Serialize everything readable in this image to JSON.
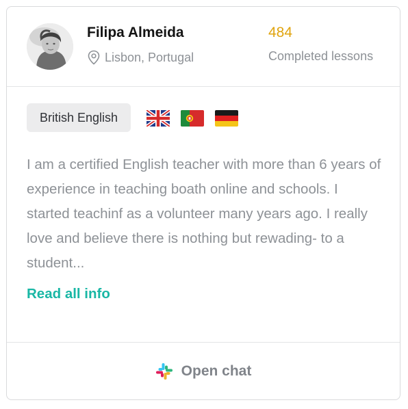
{
  "profile": {
    "name": "Filipa Almeida",
    "location": "Lisbon, Portugal",
    "lessons_count": "484",
    "lessons_label": "Completed lessons"
  },
  "languages": {
    "tag": "British English",
    "flags": [
      "uk-flag-icon",
      "portugal-flag-icon",
      "germany-flag-icon"
    ]
  },
  "bio": {
    "text": "I am a certified English teacher with more than 6 years of experience in teaching boath online and schools. I started teachinf as a volunteer many years ago. I really love and believe there is nothing but rewading- to a student...",
    "read_more": "Read all info"
  },
  "footer": {
    "icon": "slack-icon",
    "label": "Open chat"
  },
  "colors": {
    "accent": "#19b7a5",
    "lessons": "#e0a40f",
    "muted": "#8d9196",
    "border": "#d9dadc"
  }
}
